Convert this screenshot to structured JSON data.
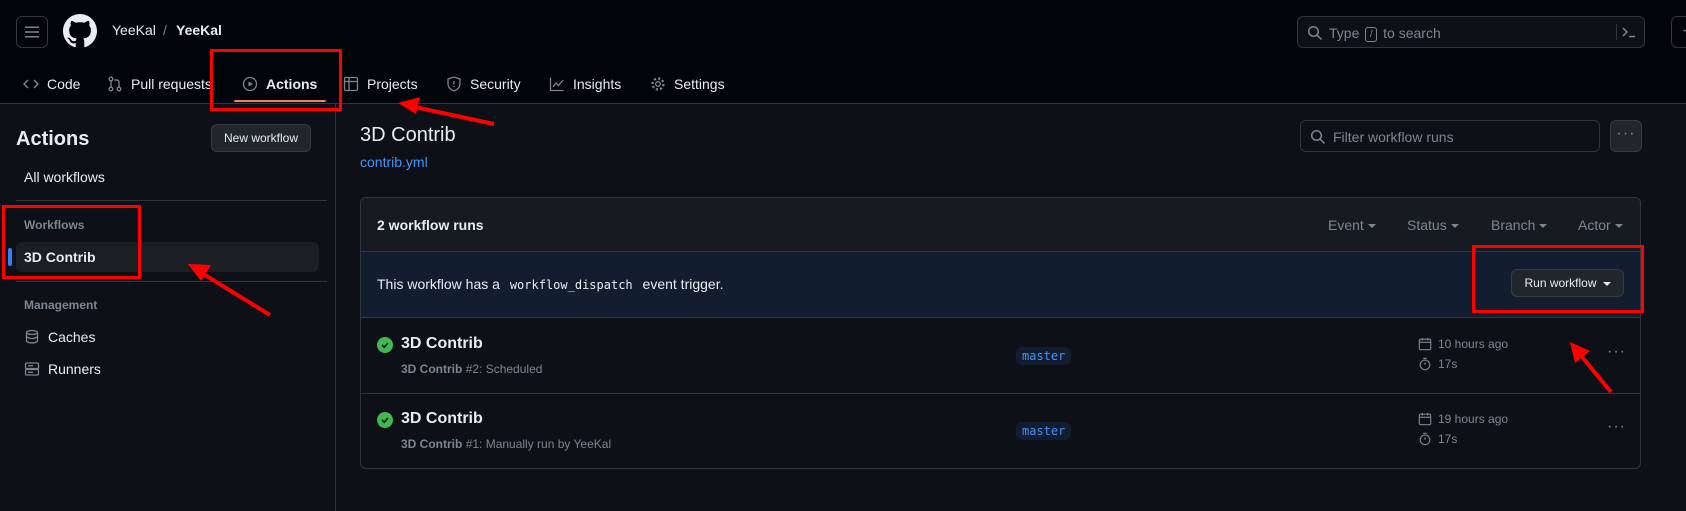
{
  "header": {
    "owner": "YeeKal",
    "separator": "/",
    "repo": "YeeKal",
    "search_placeholder_before": "Type",
    "search_key": "/",
    "search_placeholder_after": "to search"
  },
  "tabs": [
    {
      "label": "Code",
      "icon": "code-icon"
    },
    {
      "label": "Pull requests",
      "icon": "pull-request-icon"
    },
    {
      "label": "Actions",
      "icon": "play-icon",
      "active": true
    },
    {
      "label": "Projects",
      "icon": "table-icon"
    },
    {
      "label": "Security",
      "icon": "shield-icon"
    },
    {
      "label": "Insights",
      "icon": "graph-icon"
    },
    {
      "label": "Settings",
      "icon": "gear-icon"
    }
  ],
  "sidebar": {
    "title": "Actions",
    "new_workflow": "New workflow",
    "all_workflows": "All workflows",
    "workflows_heading": "Workflows",
    "selected_workflow": "3D Contrib",
    "management_heading": "Management",
    "caches": "Caches",
    "runners": "Runners"
  },
  "main": {
    "title": "3D Contrib",
    "file": "contrib.yml",
    "filter_placeholder": "Filter workflow runs",
    "runs_count": "2 workflow runs",
    "filters": [
      "Event",
      "Status",
      "Branch",
      "Actor"
    ],
    "dispatch_before": "This workflow has a",
    "dispatch_code": "workflow_dispatch",
    "dispatch_after": "event trigger.",
    "run_workflow": "Run workflow",
    "runs": [
      {
        "title": "3D Contrib",
        "workflow": "3D Contrib",
        "detail": "#2: Scheduled",
        "branch": "master",
        "time": "10 hours ago",
        "duration": "17s",
        "status": "success"
      },
      {
        "title": "3D Contrib",
        "workflow": "3D Contrib",
        "detail": "#1: Manually run by YeeKal",
        "branch": "master",
        "time": "19 hours ago",
        "duration": "17s",
        "status": "success"
      }
    ]
  },
  "colors": {
    "accent": "#f78166",
    "success": "#3fb950",
    "link": "#4493f8",
    "annotation": "#ff0000"
  }
}
